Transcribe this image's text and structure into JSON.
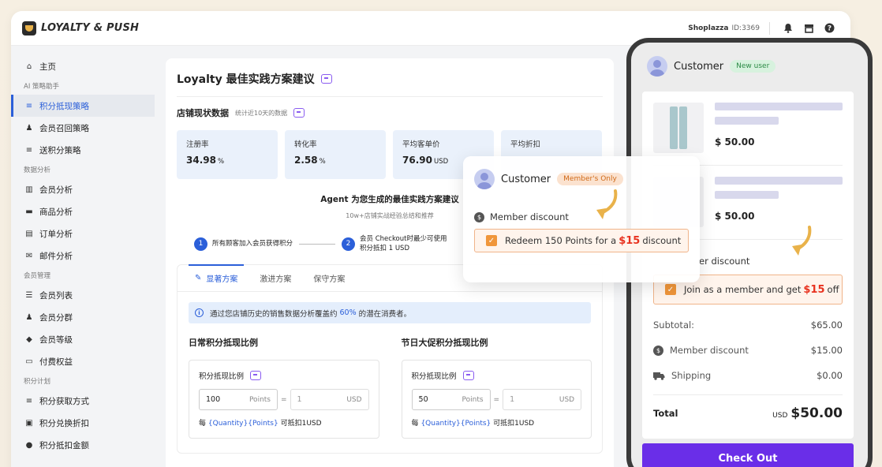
{
  "topbar": {
    "app_name": "LOYALTY & PUSH",
    "store_name": "Shoplazza",
    "store_id": "ID:3369",
    "icons": [
      "bell-icon",
      "store-icon",
      "help-icon"
    ]
  },
  "sidebar": {
    "items": [
      {
        "type": "item",
        "label": "主页",
        "icon": "home-icon"
      },
      {
        "type": "group",
        "label": "AI 策略助手"
      },
      {
        "type": "item",
        "label": "积分抵现策略",
        "icon": "strategy-icon",
        "active": true
      },
      {
        "type": "item",
        "label": "会员召回策略",
        "icon": "recall-icon"
      },
      {
        "type": "item",
        "label": "送积分策略",
        "icon": "gift-points-icon"
      },
      {
        "type": "group",
        "label": "数据分析"
      },
      {
        "type": "item",
        "label": "会员分析",
        "icon": "bar-chart-icon"
      },
      {
        "type": "item",
        "label": "商品分析",
        "icon": "bag-icon"
      },
      {
        "type": "item",
        "label": "订单分析",
        "icon": "order-icon"
      },
      {
        "type": "item",
        "label": "邮件分析",
        "icon": "mail-icon"
      },
      {
        "type": "group",
        "label": "会员管理"
      },
      {
        "type": "item",
        "label": "会员列表",
        "icon": "list-icon"
      },
      {
        "type": "item",
        "label": "会员分群",
        "icon": "users-icon"
      },
      {
        "type": "item",
        "label": "会员等级",
        "icon": "diamond-icon"
      },
      {
        "type": "item",
        "label": "付费权益",
        "icon": "card-icon"
      },
      {
        "type": "group",
        "label": "积分计划"
      },
      {
        "type": "item",
        "label": "积分获取方式",
        "icon": "earn-icon"
      },
      {
        "type": "item",
        "label": "积分兑换折扣",
        "icon": "redeem-icon"
      },
      {
        "type": "item",
        "label": "积分抵扣金额",
        "icon": "coin-icon"
      }
    ]
  },
  "main": {
    "title": "Loyalty 最佳实践方案建议",
    "store_data_title": "店铺现状数据",
    "store_data_sub": "统计近10天的数据",
    "stats": [
      {
        "label": "注册率",
        "value": "34.98",
        "unit": "%"
      },
      {
        "label": "转化率",
        "value": "2.58",
        "unit": "%"
      },
      {
        "label": "平均客单价",
        "value": "76.90",
        "unit": "USD"
      },
      {
        "label": "平均折扣",
        "value": "",
        "unit": ""
      }
    ],
    "agent_title": "Agent 为您生成的最佳实践方案建议",
    "agent_sub": "10w+店铺实战经验总结和推荐",
    "steps": [
      {
        "num": "1",
        "text": "所有顾客加入会员获得积分"
      },
      {
        "num": "2",
        "text_line1": "会员 Checkout时最少可使用",
        "text_line2": "积分抵扣 1 USD"
      }
    ],
    "tabs": [
      "显著方案",
      "激进方案",
      "保守方案"
    ],
    "info_prefix": "通过您店铺历史的销售数据分析覆盖约",
    "info_percent": "60%",
    "info_suffix": "的潜在消费者。",
    "ratio_cols": [
      {
        "title": "日常积分抵现比例",
        "box_title": "积分抵现比例",
        "points_value": "100",
        "points_unit": "Points",
        "usd_value": "1",
        "usd_unit": "USD",
        "note_prefix": "每",
        "note_var": "{Quantity}{Points}",
        "note_suffix": "可抵扣1USD"
      },
      {
        "title": "节日大促积分抵现比例",
        "box_title": "积分抵现比例",
        "points_value": "50",
        "points_unit": "Points",
        "usd_value": "1",
        "usd_unit": "USD",
        "note_prefix": "每",
        "note_var": "{Quantity}{Points}",
        "note_suffix": "可抵扣1USD"
      }
    ]
  },
  "member_card": {
    "customer": "Customer",
    "badge": "Member's Only",
    "discount_label": "Member discount",
    "redeem_prefix": "Redeem 150 Points for a",
    "redeem_amount": "$15",
    "redeem_suffix": "discount"
  },
  "phone": {
    "customer": "Customer",
    "badge": "New user",
    "products": [
      {
        "price": "$ 50.00"
      },
      {
        "price": "$ 50.00"
      }
    ],
    "discount_label": "er discount",
    "join_prefix": "Join as a member and get",
    "join_amount": "$15",
    "join_suffix": "off",
    "summary": [
      {
        "label": "Subtotal:",
        "value": "$65.00",
        "icon": ""
      },
      {
        "label": "Member discount",
        "value": "$15.00",
        "icon": "dollar-coin-icon"
      },
      {
        "label": "Shipping",
        "value": "$0.00",
        "icon": "truck-icon"
      }
    ],
    "total_label": "Total",
    "total_currency": "USD",
    "total_value": "$50.00",
    "checkout_label": "Check Out"
  },
  "colors": {
    "accent_blue": "#2b5fd9",
    "checkout_purple": "#6a2ee8",
    "discount_red": "#e8321f",
    "orange": "#f0963a"
  }
}
